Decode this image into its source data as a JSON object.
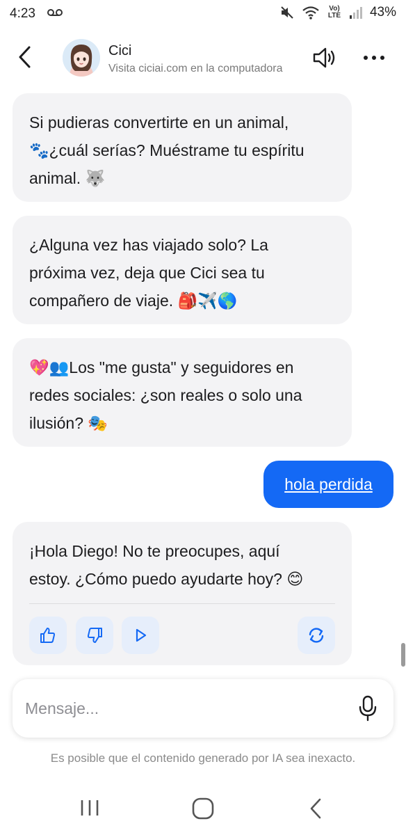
{
  "status_bar": {
    "time": "4:23",
    "network": "Vo) LTE",
    "battery": "43%"
  },
  "header": {
    "bot_name": "Cici",
    "subtitle": "Visita ciciai.com en la computadora"
  },
  "messages": [
    {
      "role": "bot",
      "lines": [
        "Si pudieras convertirte en un animal,",
        "🐾¿cuál serías? Muéstrame tu espíritu",
        "animal. 🐺"
      ]
    },
    {
      "role": "bot",
      "lines": [
        "¿Alguna vez has viajado solo? La",
        "próxima vez, deja que Cici sea tu",
        "compañero de viaje. 🎒✈️🌎"
      ]
    },
    {
      "role": "bot",
      "lines": [
        "💖👥Los \"me gusta\" y seguidores en",
        "redes sociales: ¿son reales o solo una",
        "ilusión? 🎭"
      ]
    },
    {
      "role": "user",
      "text": "hola perdida"
    },
    {
      "role": "bot",
      "lines": [
        "¡Hola Diego! No te preocupes, aquí",
        "estoy. ¿Cómo puedo ayudarte hoy? 😊"
      ]
    }
  ],
  "input": {
    "placeholder": "Mensaje..."
  },
  "disclaimer": "Es posible que el contenido generado por IA sea inexacto.",
  "colors": {
    "accent": "#1469f5",
    "bubble_bg": "#f3f3f5",
    "feedback_bg": "#e6eefb"
  },
  "icons": [
    "back-arrow-icon",
    "speaker-icon",
    "more-icon",
    "thumbs-up-icon",
    "thumbs-down-icon",
    "play-icon",
    "regenerate-icon",
    "microphone-icon"
  ]
}
